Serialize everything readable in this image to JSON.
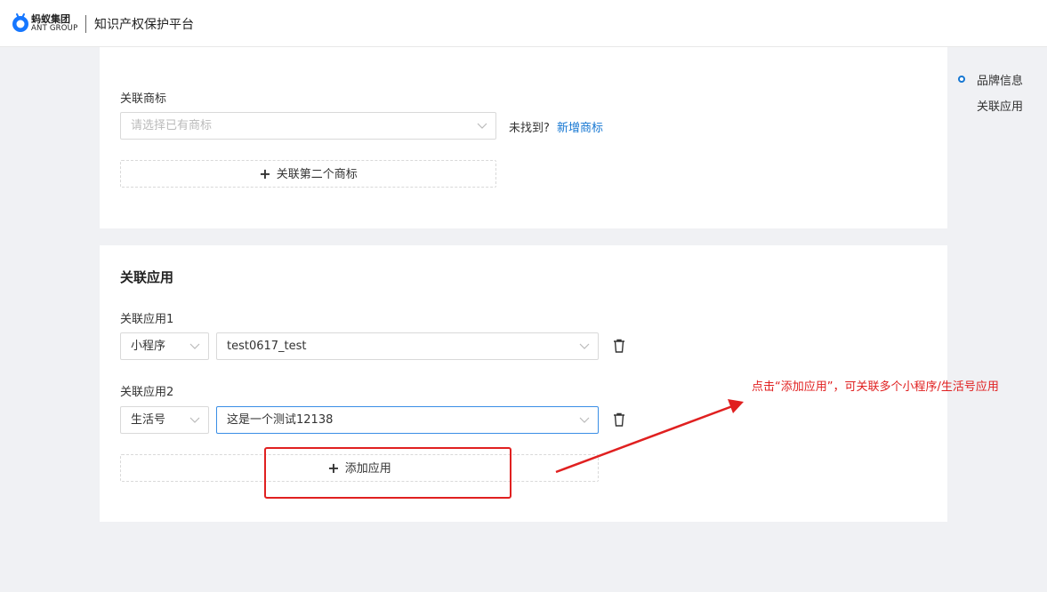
{
  "header": {
    "logo_cn": "蚂蚁集团",
    "logo_en": "ANT GROUP",
    "platform_title": "知识产权保护平台"
  },
  "trademark": {
    "label": "关联商标",
    "select_placeholder": "请选择已有商标",
    "not_found_text": "未找到?",
    "add_trademark_link": "新增商标",
    "add_second_button": "关联第二个商标"
  },
  "apps": {
    "section_title": "关联应用",
    "items": [
      {
        "label": "关联应用1",
        "type": "小程序",
        "name": "test0617_test"
      },
      {
        "label": "关联应用2",
        "type": "生活号",
        "name": "这是一个测试12138"
      }
    ],
    "add_button": "添加应用"
  },
  "anchor_nav": {
    "items": [
      "品牌信息",
      "关联应用"
    ],
    "active": "品牌信息"
  },
  "annotation": {
    "text": "点击“添加应用”，可关联多个小程序/生活号应用",
    "color": "#e02020"
  },
  "colors": {
    "accent": "#1677d2",
    "background": "#f0f1f4",
    "annotation": "#e02020"
  }
}
